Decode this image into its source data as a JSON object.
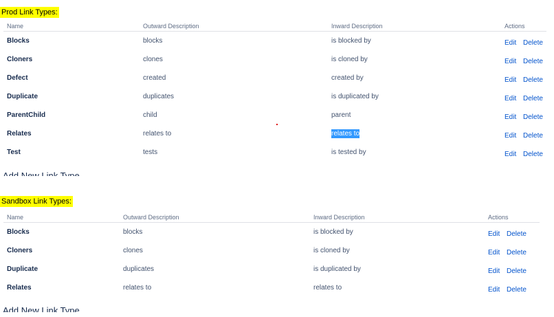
{
  "prod": {
    "label": "Prod Link Types:",
    "headers": {
      "name": "Name",
      "outward": "Outward Description",
      "inward": "Inward Description",
      "actions": "Actions"
    },
    "rows": [
      {
        "name": "Blocks",
        "outward": "blocks",
        "inward": "is blocked by",
        "edit": "Edit",
        "delete": "Delete"
      },
      {
        "name": "Cloners",
        "outward": "clones",
        "inward": "is cloned by",
        "edit": "Edit",
        "delete": "Delete"
      },
      {
        "name": "Defect",
        "outward": "created",
        "inward": "created by",
        "edit": "Edit",
        "delete": "Delete"
      },
      {
        "name": "Duplicate",
        "outward": "duplicates",
        "inward": "is duplicated by",
        "edit": "Edit",
        "delete": "Delete"
      },
      {
        "name": "ParentChild",
        "outward": "child",
        "inward": "parent",
        "edit": "Edit",
        "delete": "Delete"
      },
      {
        "name": "Relates",
        "outward": "relates to",
        "inward": "relates to",
        "edit": "Edit",
        "delete": "Delete"
      },
      {
        "name": "Test",
        "outward": "tests",
        "inward": "is tested by",
        "edit": "Edit",
        "delete": "Delete"
      }
    ],
    "add_new": "Add New Link Type"
  },
  "sandbox": {
    "label": "Sandbox Link Types:",
    "headers": {
      "name": "Name",
      "outward": "Outward Description",
      "inward": "Inward Description",
      "actions": "Actions"
    },
    "rows": [
      {
        "name": "Blocks",
        "outward": "blocks",
        "inward": "is blocked by",
        "edit": "Edit",
        "delete": "Delete"
      },
      {
        "name": "Cloners",
        "outward": "clones",
        "inward": "is cloned by",
        "edit": "Edit",
        "delete": "Delete"
      },
      {
        "name": "Duplicate",
        "outward": "duplicates",
        "inward": "is duplicated by",
        "edit": "Edit",
        "delete": "Delete"
      },
      {
        "name": "Relates",
        "outward": "relates to",
        "inward": "relates to",
        "edit": "Edit",
        "delete": "Delete"
      }
    ],
    "add_new": "Add New Link Type"
  },
  "colors": {
    "highlight": "#ffff00",
    "link": "#0052cc",
    "selection": "#3399ff"
  }
}
